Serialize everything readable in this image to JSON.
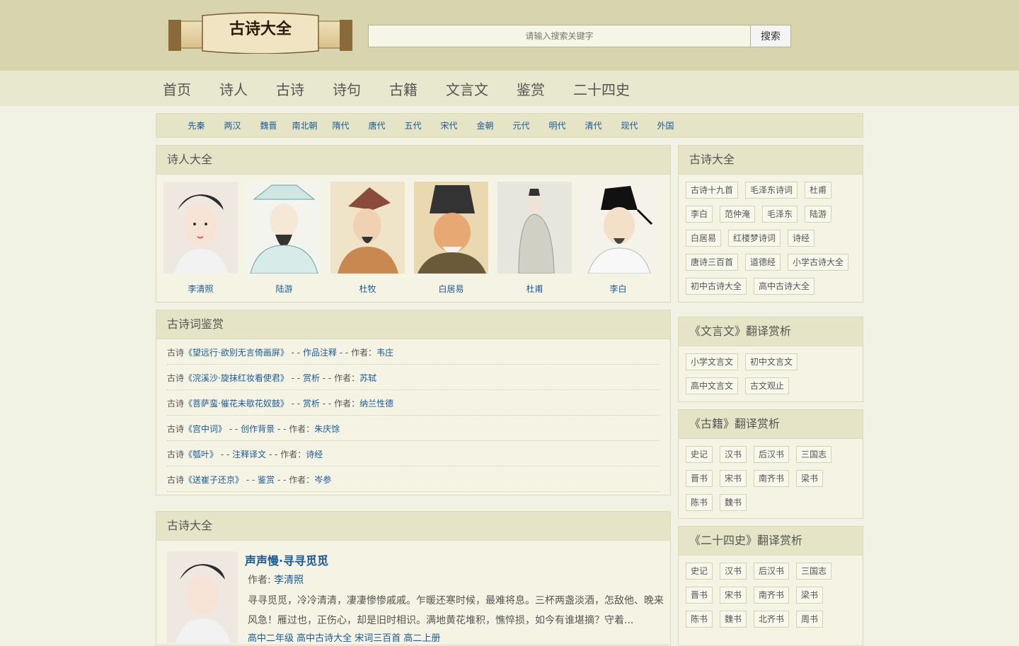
{
  "logo": {
    "text": "古诗大全"
  },
  "search": {
    "placeholder": "请输入搜索关键字",
    "button": "搜索"
  },
  "nav": [
    "首页",
    "诗人",
    "古诗",
    "诗句",
    "古籍",
    "文言文",
    "鉴赏",
    "二十四史"
  ],
  "dynasties": [
    "先秦",
    "两汉",
    "魏晋",
    "南北朝",
    "隋代",
    "唐代",
    "五代",
    "宋代",
    "金朝",
    "元代",
    "明代",
    "清代",
    "现代",
    "外国"
  ],
  "poets_panel": {
    "title": "诗人大全",
    "poets": [
      "李清照",
      "陆游",
      "杜牧",
      "白居易",
      "杜甫",
      "李白"
    ]
  },
  "appreciation": {
    "title": "古诗词鉴赏",
    "rows": [
      {
        "prefix": "古诗",
        "poem": "《望远行·欲别无言倚画屏》",
        "sep": " - - ",
        "kind": "作品注释",
        "sep2": " - - 作者：",
        "author": "韦庄"
      },
      {
        "prefix": "古诗",
        "poem": "《浣溪沙·旋抹红妆看使君》",
        "sep": " - - ",
        "kind": "赏析",
        "sep2": " - - 作者：",
        "author": "苏轼"
      },
      {
        "prefix": "古诗",
        "poem": "《菩萨蛮·催花未歇花奴鼓》",
        "sep": " - - ",
        "kind": "赏析",
        "sep2": " - - 作者：",
        "author": "纳兰性德"
      },
      {
        "prefix": "古诗",
        "poem": "《宫中词》",
        "sep": " - - ",
        "kind": "创作背景",
        "sep2": " - - 作者：",
        "author": "朱庆馀"
      },
      {
        "prefix": "古诗",
        "poem": "《瓠叶》",
        "sep": " - - ",
        "kind": "注释译文",
        "sep2": " - - 作者：",
        "author": "诗经"
      },
      {
        "prefix": "古诗",
        "poem": "《送崔子还京》",
        "sep": " - - ",
        "kind": "鉴赏",
        "sep2": " - - 作者：",
        "author": "岑参"
      }
    ]
  },
  "poems_panel": {
    "title": "古诗大全",
    "feature": {
      "title": "声声慢·寻寻觅觅",
      "author_label": "作者:",
      "author": "李清照",
      "line1": "寻寻觅觅，冷冷清清，凄凄惨惨戚戚。乍暖还寒时候，最难将息。三杯两盏淡酒，怎敌他、晚来",
      "line2": "风急！雁过也，正伤心，却是旧时相识。满地黄花堆积，憔悴损，如今有谁堪摘？守着...",
      "tags": "高中二年级 高中古诗大全 宋词三百首 高二上册"
    }
  },
  "side_poems": {
    "title": "古诗大全",
    "tags": [
      "古诗十九首",
      "毛泽东诗词",
      "杜甫",
      "李白",
      "范仲淹",
      "毛泽东",
      "陆游",
      "白居易",
      "红楼梦诗词",
      "诗经",
      "唐诗三百首",
      "道德经",
      "小学古诗大全",
      "初中古诗大全",
      "高中古诗大全"
    ]
  },
  "side_wenyan": {
    "title": "《文言文》翻译赏析",
    "tags": [
      "小学文言文",
      "初中文言文",
      "高中文言文",
      "古文观止"
    ]
  },
  "side_guji": {
    "title": "《古籍》翻译赏析",
    "tags": [
      "史记",
      "汉书",
      "后汉书",
      "三国志",
      "晋书",
      "宋书",
      "南齐书",
      "梁书",
      "陈书",
      "魏书"
    ]
  },
  "side_shi": {
    "title": "《二十四史》翻译赏析",
    "tags": [
      "史记",
      "汉书",
      "后汉书",
      "三国志",
      "晋书",
      "宋书",
      "南齐书",
      "梁书",
      "陈书",
      "魏书",
      "北齐书",
      "周书"
    ]
  },
  "colors": {
    "link": "#1a5a96",
    "header_bg": "#d8d4ad",
    "nav_bg": "#e8e8cf",
    "page_bg": "#f2f2e4"
  }
}
